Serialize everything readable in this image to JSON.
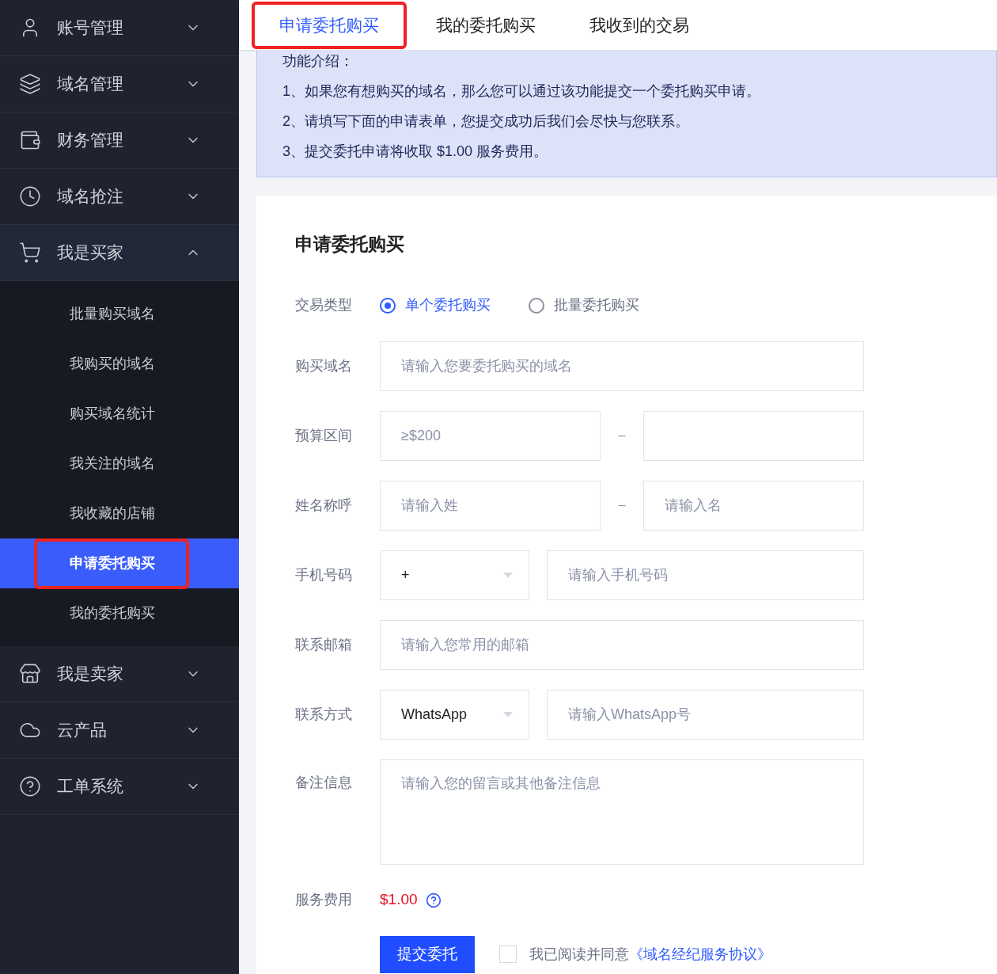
{
  "sidebar": {
    "menus": [
      {
        "label": "账号管理",
        "expanded": false
      },
      {
        "label": "域名管理",
        "expanded": false
      },
      {
        "label": "财务管理",
        "expanded": false
      },
      {
        "label": "域名抢注",
        "expanded": false
      },
      {
        "label": "我是买家",
        "expanded": true,
        "children": [
          {
            "label": "批量购买域名",
            "selected": false,
            "highlighted": false
          },
          {
            "label": "我购买的域名",
            "selected": false,
            "highlighted": false
          },
          {
            "label": "购买域名统计",
            "selected": false,
            "highlighted": false
          },
          {
            "label": "我关注的域名",
            "selected": false,
            "highlighted": false
          },
          {
            "label": "我收藏的店铺",
            "selected": false,
            "highlighted": false
          },
          {
            "label": "申请委托购买",
            "selected": true,
            "highlighted": true
          },
          {
            "label": "我的委托购买",
            "selected": false,
            "highlighted": false
          }
        ]
      },
      {
        "label": "我是卖家",
        "expanded": false
      },
      {
        "label": "云产品",
        "expanded": false
      },
      {
        "label": "工单系统",
        "expanded": false
      }
    ]
  },
  "tabs": [
    {
      "label": "申请委托购买",
      "selected": true,
      "highlighted": true
    },
    {
      "label": "我的委托购买",
      "selected": false,
      "highlighted": false
    },
    {
      "label": "我收到的交易",
      "selected": false,
      "highlighted": false
    }
  ],
  "intro": {
    "title": "功能介绍：",
    "lines": [
      "1、如果您有想购买的域名，那么您可以通过该功能提交一个委托购买申请。",
      "2、请填写下面的申请表单，您提交成功后我们会尽快与您联系。",
      "3、提交委托申请将收取 $1.00 服务费用。"
    ]
  },
  "form": {
    "title": "申请委托购买",
    "fields": [
      {
        "kind": "radio",
        "label": "交易类型",
        "options": [
          {
            "label": "单个委托购买",
            "selected": true
          },
          {
            "label": "批量委托购买",
            "selected": false
          }
        ]
      },
      {
        "kind": "input",
        "label": "购买域名",
        "placeholder": "请输入您要委托购买的域名"
      },
      {
        "kind": "pair",
        "label": "预算区间",
        "separator": "–",
        "left_placeholder": "≥$200"
      },
      {
        "kind": "pair",
        "label": "姓名称呼",
        "separator": "–",
        "left_placeholder": "请输入姓",
        "right_placeholder": "请输入名"
      },
      {
        "kind": "select_input",
        "label": "手机号码",
        "select": "+",
        "placeholder": "请输入手机号码"
      },
      {
        "kind": "input",
        "label": "联系邮箱",
        "placeholder": "请输入您常用的邮箱"
      },
      {
        "kind": "select_input",
        "label": "联系方式",
        "select": "WhatsApp",
        "placeholder": "请输入WhatsApp号"
      },
      {
        "kind": "textarea",
        "label": "备注信息",
        "placeholder": "请输入您的留言或其他备注信息"
      },
      {
        "kind": "fee",
        "label": "服务费用",
        "value": "$1.00"
      }
    ]
  },
  "submit": "提交委托",
  "agreement": {
    "checked": false,
    "text": "我已阅读并同意",
    "link": "《域名经纪服务协议》"
  }
}
